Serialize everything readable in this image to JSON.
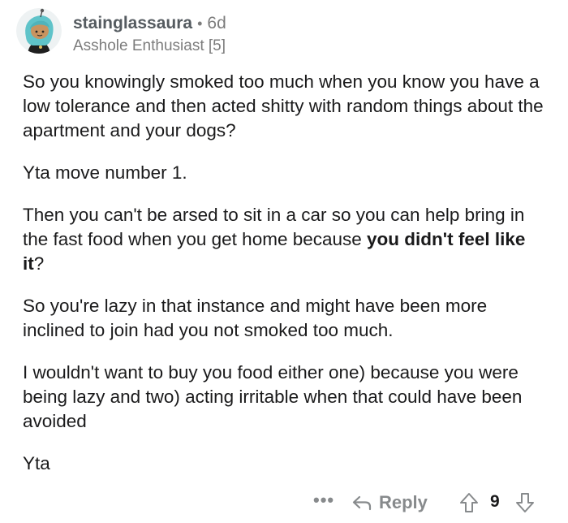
{
  "comment": {
    "author": "stainglassaura",
    "separator": "•",
    "age": "6d",
    "flair": "Asshole Enthusiast [5]",
    "avatar_icon": "snoo-avatar-icon",
    "paragraphs": [
      {
        "segments": [
          {
            "text": "So you knowingly smoked too much when you know you have a low tolerance and then acted shitty with random things about the apartment and your dogs?",
            "bold": false
          }
        ]
      },
      {
        "segments": [
          {
            "text": "Yta move number 1.",
            "bold": false
          }
        ]
      },
      {
        "segments": [
          {
            "text": "Then you can't be arsed to sit in a car so you can help bring in the fast food when you get home because ",
            "bold": false
          },
          {
            "text": "you didn't feel like it",
            "bold": true
          },
          {
            "text": "?",
            "bold": false
          }
        ]
      },
      {
        "segments": [
          {
            "text": "So you're lazy in that instance and might have been more inclined to join had you not smoked too much.",
            "bold": false
          }
        ]
      },
      {
        "segments": [
          {
            "text": "I wouldn't want to buy you food either one) because you were being lazy and two) acting irritable when that could have been avoided",
            "bold": false
          }
        ]
      },
      {
        "segments": [
          {
            "text": "Yta",
            "bold": false
          }
        ]
      }
    ]
  },
  "actions": {
    "more_label": "•••",
    "reply_label": "Reply",
    "score": "9",
    "upvote_icon": "upvote-arrow-icon",
    "downvote_icon": "downvote-arrow-icon",
    "reply_icon": "reply-arrow-icon"
  },
  "colors": {
    "text": "#1a1a1b",
    "meta": "#7c7c7c",
    "username": "#555b60",
    "avatar_bg": "#eef2f3",
    "avatar_hair": "#5fc3c9"
  }
}
